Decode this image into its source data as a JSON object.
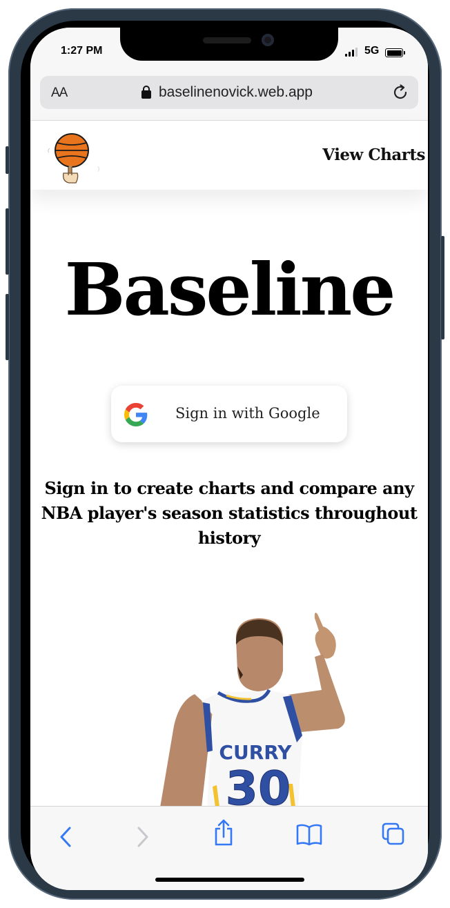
{
  "status_bar": {
    "time": "1:27 PM",
    "network": "5G",
    "icons": [
      "signal-bars-icon",
      "battery-icon"
    ]
  },
  "browser": {
    "text_size_button": "AA",
    "url": "baselinenovick.web.app",
    "icons": [
      "lock-icon",
      "reload-icon"
    ]
  },
  "site_header": {
    "logo": "basketball-spinning-on-finger-logo",
    "nav_link": "View Charts"
  },
  "main": {
    "title": "Baseline",
    "google_button_label": "Sign in with Google",
    "google_icon": "google-g-icon",
    "tagline": "Sign in to create charts and compare any NBA player's season statistics throughout history",
    "illustration": {
      "jersey_name": "CURRY",
      "jersey_number": "30"
    }
  },
  "toolbar": {
    "icons": [
      "back-icon",
      "forward-icon",
      "share-icon",
      "bookmarks-icon",
      "tabs-icon"
    ]
  },
  "colors": {
    "ios_blue": "#3478f6",
    "disabled_gray": "#c7c7cc",
    "browser_chrome": "#f7f7f7",
    "address_bar": "#e4e4e6",
    "basketball": "#e8741d",
    "jersey_blue": "#2f4fa3"
  }
}
